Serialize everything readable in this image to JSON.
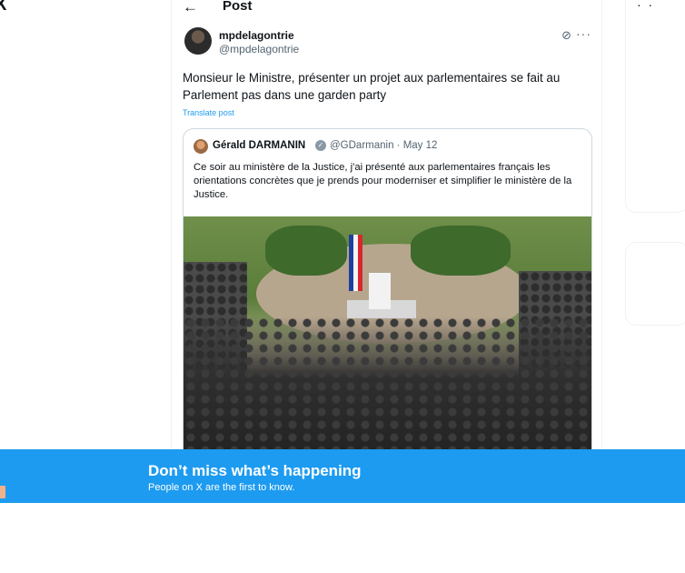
{
  "header": {
    "title": "Post",
    "back_icon": "arrow-left-icon"
  },
  "post": {
    "display_name": "mpdelagontrie",
    "handle": "@mpdelagontrie",
    "text": "Monsieur le Ministre, présenter un projet aux parlementaires se fait au Parlement pas dans une garden party",
    "translate_label": "Translate post",
    "icons": [
      "grok-icon",
      "more-icon"
    ]
  },
  "quoted_post": {
    "display_name": "Gérald DARMANIN",
    "meta": "@GDarmanin · May 12",
    "text": "Ce soir au ministère de la Justice, j'ai présenté aux parlementaires français les orientations concrètes que je prends pour moderniser et simplifier le ministère de la Justice."
  },
  "banner": {
    "title": "Don’t miss what’s happening",
    "subtitle": "People on X are the first to know."
  },
  "colors": {
    "accent": "#1d9bf0",
    "text": "#0f1419",
    "muted": "#536471"
  }
}
